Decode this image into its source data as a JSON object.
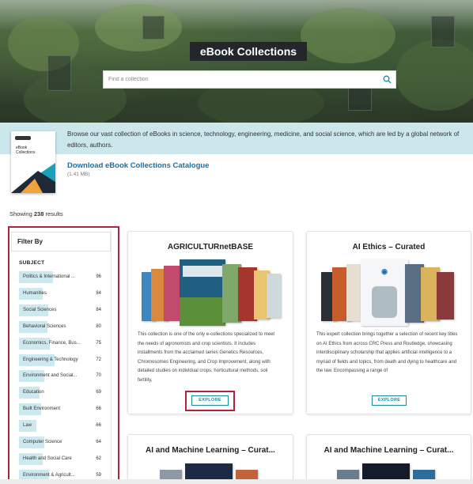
{
  "hero": {
    "title": "eBook Collections",
    "search_placeholder": "Find a collection",
    "search_icon": "magnifier-icon"
  },
  "info": {
    "description": "Browse our vast collection of eBooks in science, technology, engineering, medicine, and social science, which are led by a global network of editors, authors.",
    "catalogue_thumb_title": "eBook Collections",
    "download_label": "Download eBook Collections Catalogue",
    "file_size": "(1.41 MB)"
  },
  "results": {
    "prefix": "Showing",
    "count": "238",
    "suffix": "results"
  },
  "filter": {
    "heading": "Filter By",
    "subject_label": "SUBJECT",
    "items": [
      {
        "label": "Politics & International ...",
        "count": "96",
        "fraction": 0.4
      },
      {
        "label": "Humanities",
        "count": "84",
        "fraction": 0.28
      },
      {
        "label": "Social Sciences",
        "count": "84",
        "fraction": 0.34
      },
      {
        "label": "Behavioral Sciences",
        "count": "80",
        "fraction": 0.33
      },
      {
        "label": "Economics, Finance, Bus...",
        "count": "75",
        "fraction": 0.36
      },
      {
        "label": "Engineering & Technology",
        "count": "72",
        "fraction": 0.42
      },
      {
        "label": "Environment and Social...",
        "count": "70",
        "fraction": 0.3
      },
      {
        "label": "Education",
        "count": "69",
        "fraction": 0.24
      },
      {
        "label": "Built Environment",
        "count": "66",
        "fraction": 0.26
      },
      {
        "label": "Law",
        "count": "66",
        "fraction": 0.2
      },
      {
        "label": "Computer Science",
        "count": "64",
        "fraction": 0.3
      },
      {
        "label": "Health and Social Care",
        "count": "62",
        "fraction": 0.28
      },
      {
        "label": "Environment & Agricult...",
        "count": "59",
        "fraction": 0.35
      }
    ]
  },
  "cards": [
    {
      "title": "AGRICULTURnetBASE",
      "description": "This collection is one of the only e-collections specialized to meet the needs of agronomists and crop scientists. It includes installments from the acclaimed series Genetics Resources, Chromosomes Engineering, and Crop Improvement, along with detailed studies on individual crops, horticultural methods, soil fertility,",
      "button": "EXPLORE"
    },
    {
      "title": "AI Ethics – Curated",
      "description": "This expert collection brings together a selection of recent key titles on AI Ethics from across CRC Press and Routledge, showcasing interdisciplinary scholarship that applies artificial intelligence to a myriad of fields and topics, from death and dying to healthcare and the law. Encompassing a range of",
      "button": "EXPLORE"
    },
    {
      "title": "AI and Machine Learning – Curat..."
    },
    {
      "title": "AI and Machine Learning – Curat..."
    }
  ],
  "colors": {
    "accent_link": "#1b6fa8",
    "explore_teal": "#1d8aa0",
    "highlight_red": "#b3233f",
    "facet_fill": "#cde9f0",
    "info_band": "#cbe7ec"
  }
}
